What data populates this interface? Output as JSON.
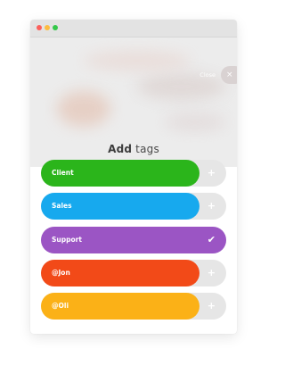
{
  "window": {
    "controls": [
      "close",
      "minimize",
      "zoom"
    ]
  },
  "header": {
    "close_label": "Close",
    "close_icon": "×",
    "title_bold": "Add",
    "title_rest": " tags"
  },
  "tags": [
    {
      "label": "Client",
      "color": "#2bb51b",
      "selected": false,
      "action_icon": "+"
    },
    {
      "label": "Sales",
      "color": "#17a9ee",
      "selected": false,
      "action_icon": "+"
    },
    {
      "label": "Support",
      "color": "#9b55c4",
      "selected": true,
      "action_icon": "✔"
    },
    {
      "label": "@Jon",
      "color": "#f24a18",
      "selected": false,
      "action_icon": "+"
    },
    {
      "label": "@Oli",
      "color": "#fbb117",
      "selected": false,
      "action_icon": "+"
    }
  ]
}
